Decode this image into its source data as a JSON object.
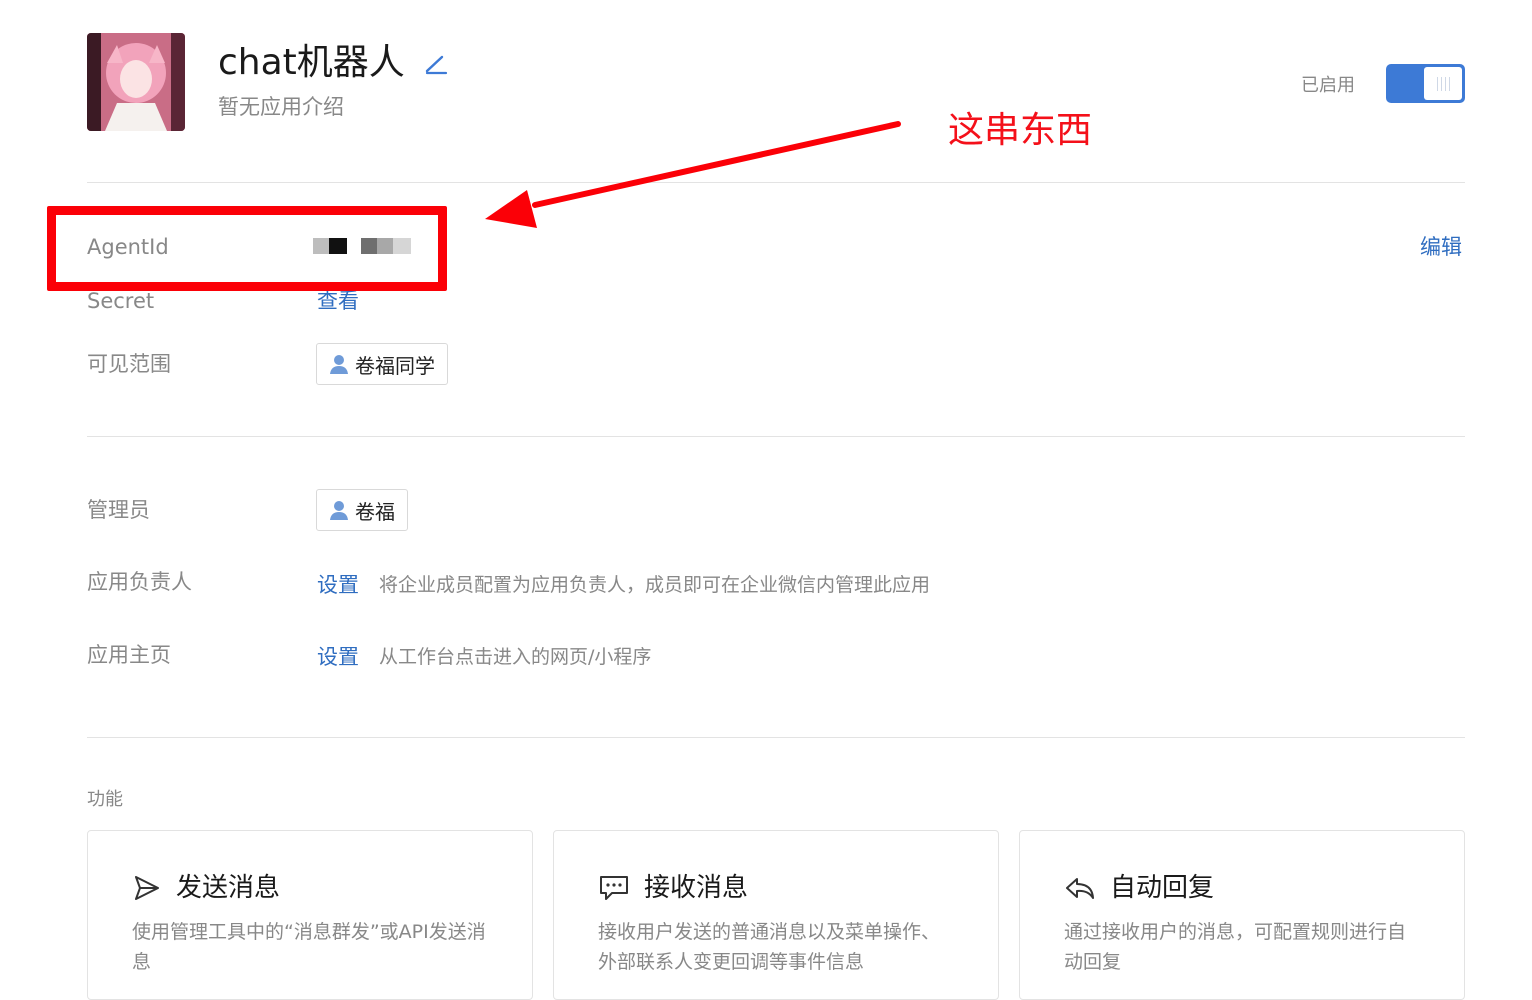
{
  "app": {
    "name": "chat机器人",
    "description": "暂无应用介绍",
    "status_label": "已启用",
    "enabled": true
  },
  "info": {
    "agentid_label": "AgentId",
    "secret_label": "Secret",
    "secret_action": "查看",
    "edit_action": "编辑",
    "visibility_label": "可见范围",
    "visibility_tag": "卷福同学"
  },
  "admin": {
    "admin_label": "管理员",
    "admin_tag": "卷福",
    "owner_label": "应用负责人",
    "owner_action": "设置",
    "owner_hint": "将企业成员配置为应用负责人，成员即可在企业微信内管理此应用",
    "homepage_label": "应用主页",
    "homepage_action": "设置",
    "homepage_hint": "从工作台点击进入的网页/小程序"
  },
  "features": {
    "section_title": "功能",
    "cards": [
      {
        "title": "发送消息",
        "desc": "使用管理工具中的“消息群发”或API发送消息",
        "icon": "send-icon"
      },
      {
        "title": "接收消息",
        "desc": "接收用户发送的普通消息以及菜单操作、外部联系人变更回调等事件信息",
        "icon": "chat-bubble-icon"
      },
      {
        "title": "自动回复",
        "desc": "通过接收用户的消息，可配置规则进行自动回复",
        "icon": "reply-icon"
      }
    ]
  },
  "annotation": {
    "text": "这串东西"
  },
  "colors": {
    "accent": "#3d7ad6",
    "link": "#2f6dc0",
    "annotation_red": "#fb0007"
  }
}
